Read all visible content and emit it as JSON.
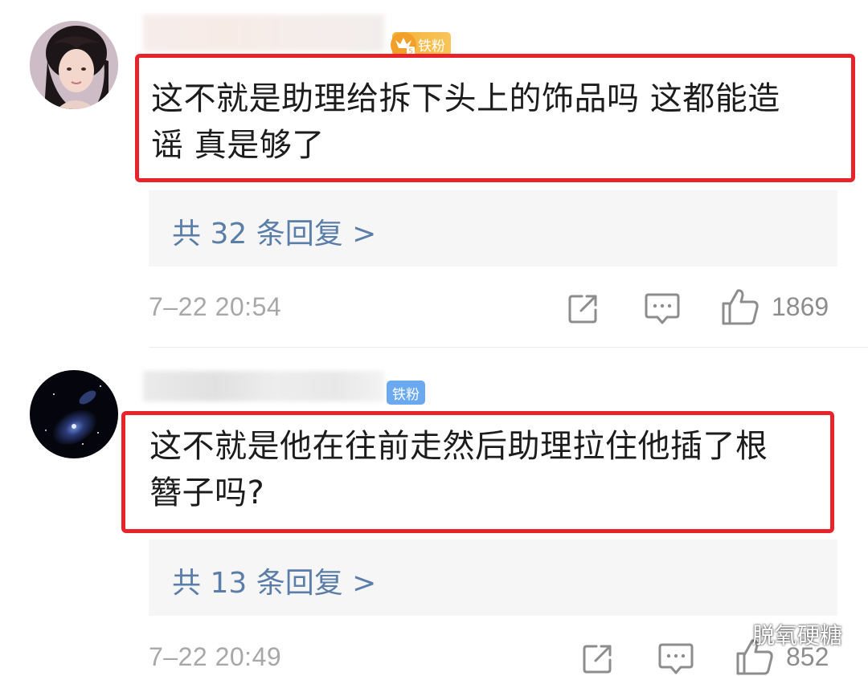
{
  "comments": [
    {
      "badge": "铁粉",
      "text_line1": "这不就是助理给拆下头上的饰品吗 这都能造",
      "text_line2": "谣 真是够了",
      "reply_link": "共 32 条回复 >",
      "timestamp": "7–22 20:54",
      "likes": "1869"
    },
    {
      "badge": "铁粉",
      "text_line1": "这不就是他在往前走然后助理拉住他插了根",
      "text_line2": "簪子吗?",
      "reply_link": "共 13 条回复 >",
      "timestamp": "7–22 20:49",
      "likes": "852"
    }
  ],
  "watermark": {
    "label": "脱氧硬糖"
  },
  "colors": {
    "highlight_border": "#e8242a",
    "link": "#5b7ea8",
    "muted": "#a8a8a8",
    "gold_badge": "#f4b13a",
    "blue_badge": "#6aa8f0"
  },
  "icons": {
    "share": "share-icon",
    "comment": "comment-icon",
    "like": "thumbs-up-icon"
  }
}
